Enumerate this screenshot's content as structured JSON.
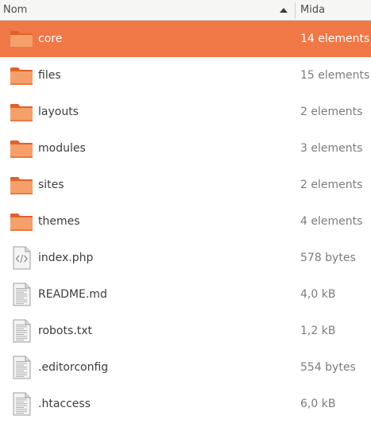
{
  "columns": {
    "name": "Nom",
    "size": "Mida"
  },
  "colors": {
    "selection": "#f07746",
    "folder_light": "#f5a06a",
    "folder_dark": "#e2602b"
  },
  "files": [
    {
      "name": "core",
      "size": "14 elements",
      "type": "folder",
      "icon": "folder-icon",
      "selected": true
    },
    {
      "name": "files",
      "size": "15 elements",
      "type": "folder",
      "icon": "folder-icon"
    },
    {
      "name": "layouts",
      "size": "2 elements",
      "type": "folder",
      "icon": "folder-icon"
    },
    {
      "name": "modules",
      "size": "3 elements",
      "type": "folder",
      "icon": "folder-icon"
    },
    {
      "name": "sites",
      "size": "2 elements",
      "type": "folder",
      "icon": "folder-icon"
    },
    {
      "name": "themes",
      "size": "4 elements",
      "type": "folder",
      "icon": "folder-icon"
    },
    {
      "name": "index.php",
      "size": "578 bytes",
      "type": "code",
      "icon": "code-file-icon"
    },
    {
      "name": "README.md",
      "size": "4,0 kB",
      "type": "text",
      "icon": "text-file-icon"
    },
    {
      "name": "robots.txt",
      "size": "1,2 kB",
      "type": "text",
      "icon": "text-file-icon"
    },
    {
      "name": ".editorconfig",
      "size": "554 bytes",
      "type": "text",
      "icon": "text-file-icon"
    },
    {
      "name": ".htaccess",
      "size": "6,0 kB",
      "type": "text",
      "icon": "text-file-icon"
    }
  ]
}
